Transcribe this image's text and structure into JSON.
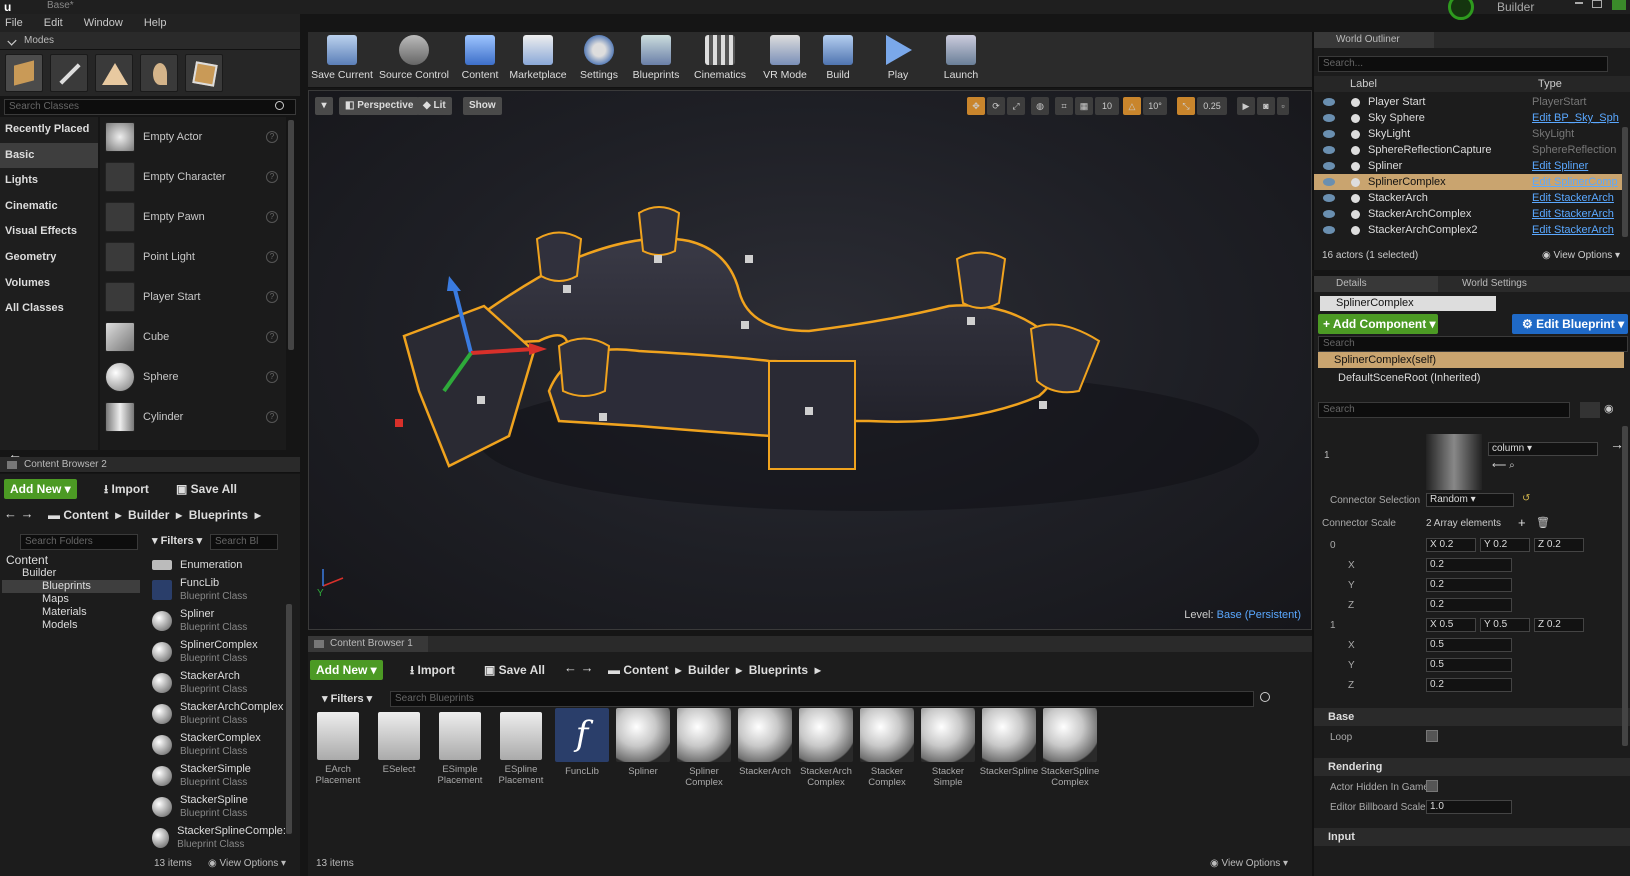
{
  "window": {
    "title": "Base*",
    "app_name": "Builder"
  },
  "menu": [
    "File",
    "Edit",
    "Window",
    "Help"
  ],
  "modes": {
    "tab_label": "Modes",
    "search_placeholder": "Search Classes",
    "categories": [
      "Recently Placed",
      "Basic",
      "Lights",
      "Cinematic",
      "Visual Effects",
      "Geometry",
      "Volumes",
      "All Classes"
    ],
    "placeables": [
      "Empty Actor",
      "Empty Character",
      "Empty Pawn",
      "Point Light",
      "Player Start",
      "Cube",
      "Sphere",
      "Cylinder"
    ]
  },
  "content_browser_2": {
    "tab": "Content Browser 2",
    "add_new": "Add New",
    "import": "Import",
    "save_all": "Save All",
    "breadcrumb": [
      "Content",
      "Builder",
      "Blueprints"
    ],
    "search_folders": "Search Folders",
    "filters": "Filters",
    "search_assets": "Search Bl",
    "tree": [
      "Content",
      "Builder",
      "Blueprints",
      "Maps",
      "Materials",
      "Models"
    ],
    "assets": [
      {
        "name": "Enumeration",
        "type": ""
      },
      {
        "name": "FuncLib",
        "type": "Blueprint Class"
      },
      {
        "name": "Spliner",
        "type": "Blueprint Class"
      },
      {
        "name": "SplinerComplex",
        "type": "Blueprint Class"
      },
      {
        "name": "StackerArch",
        "type": "Blueprint Class"
      },
      {
        "name": "StackerArchComplex",
        "type": "Blueprint Class"
      },
      {
        "name": "StackerComplex",
        "type": "Blueprint Class"
      },
      {
        "name": "StackerSimple",
        "type": "Blueprint Class"
      },
      {
        "name": "StackerSpline",
        "type": "Blueprint Class"
      },
      {
        "name": "StackerSplineComple:",
        "type": "Blueprint Class"
      }
    ],
    "item_count": "13 items",
    "view_options": "View Options"
  },
  "toolbar": [
    "Save Current",
    "Source Control",
    "Content",
    "Marketplace",
    "Settings",
    "Blueprints",
    "Cinematics",
    "VR Mode",
    "Build",
    "Play",
    "Launch"
  ],
  "viewport": {
    "perspective": "Perspective",
    "lit": "Lit",
    "show": "Show",
    "grid_snap": "10",
    "rot_snap": "10°",
    "scale_snap": "0.25",
    "level_label": "Level:",
    "level_name": "Base (Persistent)"
  },
  "content_browser_1": {
    "tab": "Content Browser 1",
    "add_new": "Add New",
    "import": "Import",
    "save_all": "Save All",
    "breadcrumb": [
      "Content",
      "Builder",
      "Blueprints"
    ],
    "filters": "Filters",
    "search_placeholder": "Search Blueprints",
    "assets": [
      {
        "label": "EArch Placement",
        "kind": "doc"
      },
      {
        "label": "ESelect",
        "kind": "doc"
      },
      {
        "label": "ESimple Placement",
        "kind": "doc"
      },
      {
        "label": "ESpline Placement",
        "kind": "doc"
      },
      {
        "label": "FuncLib",
        "kind": "fn"
      },
      {
        "label": "Spliner",
        "kind": "ball"
      },
      {
        "label": "Spliner Complex",
        "kind": "ball"
      },
      {
        "label": "StackerArch",
        "kind": "ball"
      },
      {
        "label": "StackerArch Complex",
        "kind": "ball"
      },
      {
        "label": "Stacker Complex",
        "kind": "ball"
      },
      {
        "label": "Stacker Simple",
        "kind": "ball"
      },
      {
        "label": "StackerSpline",
        "kind": "ball"
      },
      {
        "label": "StackerSpline Complex",
        "kind": "ball"
      }
    ],
    "item_count": "13 items",
    "view_options": "View Options"
  },
  "outliner": {
    "tab": "World Outliner",
    "search_placeholder": "Search...",
    "col_label": "Label",
    "col_type": "Type",
    "rows": [
      {
        "label": "Player Start",
        "type": "PlayerStart",
        "link": false,
        "selected": false
      },
      {
        "label": "Sky Sphere",
        "type": "Edit BP_Sky_Sph",
        "link": true,
        "selected": false
      },
      {
        "label": "SkyLight",
        "type": "SkyLight",
        "link": false,
        "selected": false
      },
      {
        "label": "SphereReflectionCapture",
        "type": "SphereReflection",
        "link": false,
        "selected": false
      },
      {
        "label": "Spliner",
        "type": "Edit Spliner",
        "link": true,
        "selected": false
      },
      {
        "label": "SplinerComplex",
        "type": "Edit SplinerComp",
        "link": true,
        "selected": true
      },
      {
        "label": "StackerArch",
        "type": "Edit StackerArch",
        "link": true,
        "selected": false
      },
      {
        "label": "StackerArchComplex",
        "type": "Edit StackerArch",
        "link": true,
        "selected": false
      },
      {
        "label": "StackerArchComplex2",
        "type": "Edit StackerArch",
        "link": true,
        "selected": false
      }
    ],
    "status": "16 actors (1 selected)",
    "view_options": "View Options"
  },
  "details": {
    "tab_details": "Details",
    "tab_world": "World Settings",
    "actor_name": "SplinerComplex",
    "add_component": "+ Add Component",
    "edit_blueprint": "Edit Blueprint",
    "search_placeholder": "Search",
    "self_row": "SplinerComplex(self)",
    "root_row": "DefaultSceneRoot (Inherited)",
    "search2": "Search",
    "index_label": "1",
    "mesh_name": "column",
    "connector_selection_label": "Connector Selection",
    "connector_selection_value": "Random",
    "connector_scale_label": "Connector Scale",
    "connector_scale_value": "2 Array elements",
    "elem0": {
      "idx": "0",
      "x": "X 0.2",
      "y": "Y 0.2",
      "z": "Z 0.2",
      "xv": "0.2",
      "yv": "0.2",
      "zv": "0.2"
    },
    "elem1": {
      "idx": "1",
      "x": "X 0.5",
      "y": "Y 0.5",
      "z": "Z 0.2",
      "xv": "0.5",
      "yv": "0.5",
      "zv": "0.2"
    },
    "axis": [
      "X",
      "Y",
      "Z"
    ],
    "base_section": "Base",
    "loop_label": "Loop",
    "rendering_section": "Rendering",
    "hidden_label": "Actor Hidden In Game",
    "billboard_label": "Editor Billboard Scale",
    "billboard_value": "1.0",
    "input_section": "Input"
  }
}
